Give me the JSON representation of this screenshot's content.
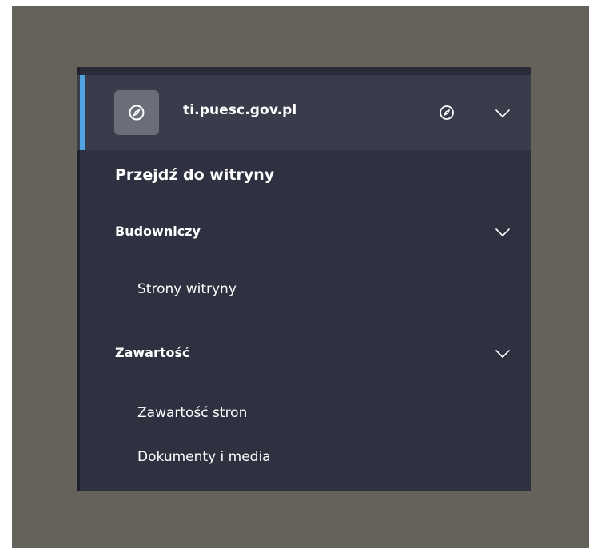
{
  "site": {
    "name": "ti.puesc.gov.pl",
    "icon": "compass-icon"
  },
  "goto_site": "Przejdź do witryny",
  "sections": [
    {
      "title": "Budowniczy",
      "items": [
        {
          "label": "Strony witryny"
        }
      ]
    },
    {
      "title": "Zawartość",
      "items": [
        {
          "label": "Zawartość stron"
        },
        {
          "label": "Dokumenty i media"
        }
      ]
    }
  ],
  "colors": {
    "frame": "#65625c",
    "menu_bg": "#2f3140",
    "header_bg": "#3a3c4c",
    "accent": "#4fa3e0",
    "icon_box": "#6b6e78"
  }
}
